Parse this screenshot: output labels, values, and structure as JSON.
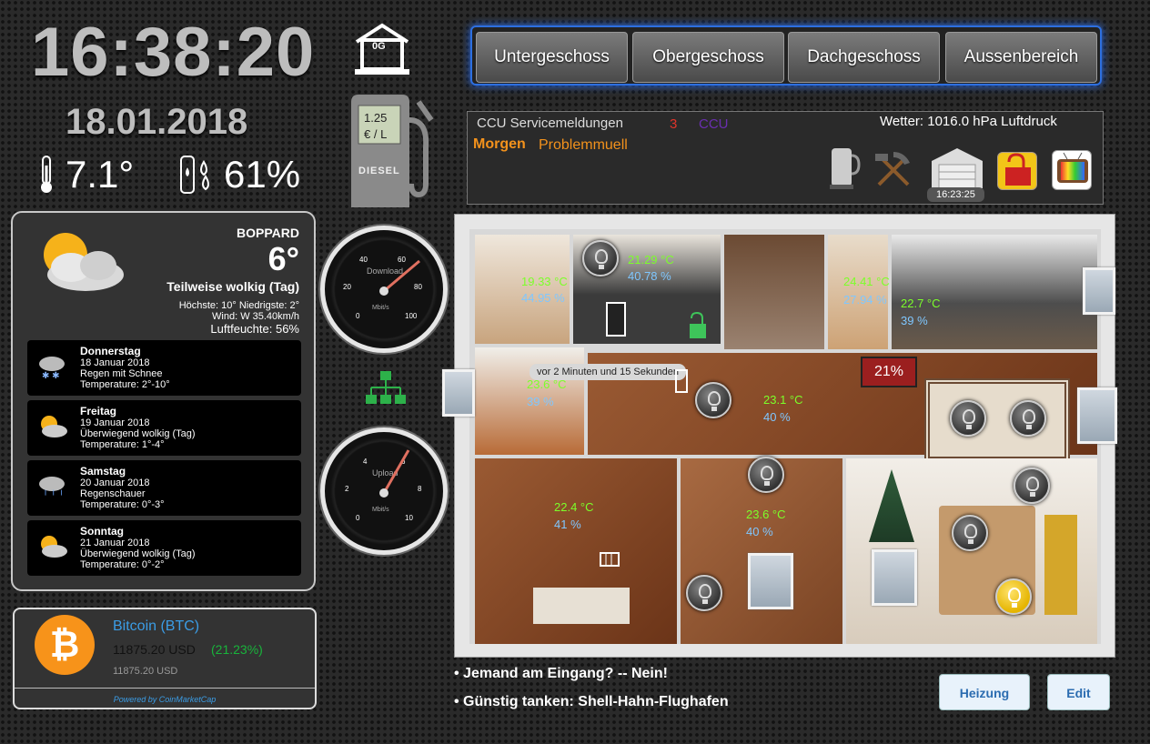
{
  "clock": {
    "time": "16:38:20",
    "date": "18.01.2018"
  },
  "sensors": {
    "temperature": "7.1°",
    "humidity": "61%"
  },
  "floor_icon_label": "0G",
  "fuel": {
    "price": "1.25",
    "unit": "€ / L",
    "label": "DIESEL"
  },
  "gauges": {
    "download": {
      "label": "Download",
      "unit": "Mbit/s",
      "ticks": [
        "0",
        "20",
        "40",
        "60",
        "80",
        "100"
      ]
    },
    "upload": {
      "label": "Upload",
      "unit": "Mbit/s",
      "ticks": [
        "0",
        "2",
        "4",
        "6",
        "8",
        "10"
      ]
    }
  },
  "weather": {
    "city": "BOPPARD",
    "temp": "6°",
    "desc": "Teilweise wolkig (Tag)",
    "hilo": "Höchste: 10° Niedrigste: 2°",
    "wind": "Wind: W 35.40km/h",
    "humidity": "Luftfeuchte: 56%",
    "days": [
      {
        "name": "Donnerstag",
        "date": "18 Januar 2018",
        "desc": "Regen mit Schnee",
        "temp": "Temperature: 2°-10°",
        "icon": "snow-rain-icon"
      },
      {
        "name": "Freitag",
        "date": "19 Januar 2018",
        "desc": "Überwiegend wolkig (Tag)",
        "temp": "Temperature: 1°-4°",
        "icon": "partly-cloudy-icon"
      },
      {
        "name": "Samstag",
        "date": "20 Januar 2018",
        "desc": "Regenschauer",
        "temp": "Temperature: 0°-3°",
        "icon": "rain-icon"
      },
      {
        "name": "Sonntag",
        "date": "21 Januar 2018",
        "desc": "Überwiegend wolkig (Tag)",
        "temp": "Temperature: 0°-2°",
        "icon": "partly-cloudy-icon"
      }
    ]
  },
  "bitcoin": {
    "name": "Bitcoin (BTC)",
    "price": "11875.20 USD",
    "change": "(21.23%)",
    "price2": "11875.20 USD",
    "powered": "Powered by CoinMarketCap"
  },
  "nav": [
    "Untergeschoss",
    "Obergeschoss",
    "Dachgeschoss",
    "Aussenbereich"
  ],
  "messages": {
    "service": "CCU Servicemeldungen",
    "count": "3",
    "ccu": "CCU",
    "weather": "Wetter: 1016.0 hPa Luftdruck",
    "line_bold": "Morgen",
    "line_rest": "Problemmuell",
    "garage_time": "16:23:25"
  },
  "rooms": [
    {
      "t": "19.33 °C",
      "h": "44.95 %"
    },
    {
      "t": "21.29 °C",
      "h": "40.78 %"
    },
    {
      "t": "24.41 °C",
      "h": "27.94 %"
    },
    {
      "t": "22.7 °C",
      "h": "39 %"
    },
    {
      "t": "23.6 °C",
      "h": "39 %"
    },
    {
      "t": "23.1 °C",
      "h": "40 %"
    },
    {
      "t": "22.4 °C",
      "h": "41 %"
    },
    {
      "t": "23.6 °C",
      "h": "40 %"
    }
  ],
  "tooltip": "vor 2 Minuten und 15 Sekunden",
  "heating_percent": "21%",
  "footer": {
    "line1": "• Jemand am Eingang? -- Nein!",
    "line2": "• Günstig tanken: Shell-Hahn-Flughafen",
    "heizung": "Heizung",
    "edit": "Edit"
  },
  "colors": {
    "accent_blue": "#2d6fe0",
    "temp_green": "#7cff2a",
    "humidity_blue": "#7fc7ff",
    "alert_red": "#9b1f1f"
  }
}
